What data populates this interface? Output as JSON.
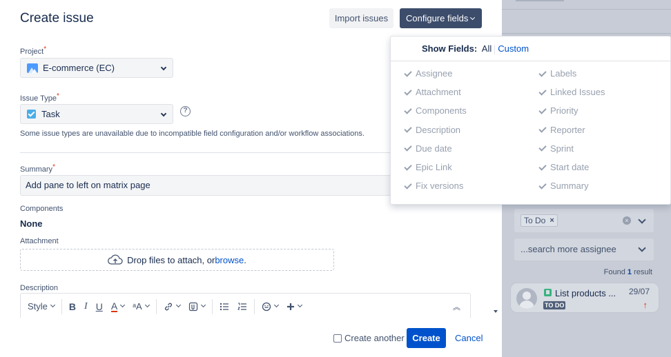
{
  "dialog": {
    "title": "Create issue",
    "import_label": "Import issues",
    "configure_label": "Configure fields"
  },
  "form": {
    "project": {
      "label": "Project",
      "required": "*",
      "value": "E-commerce (EC)"
    },
    "issue_type": {
      "label": "Issue Type",
      "required": "*",
      "value": "Task",
      "help": "?"
    },
    "note": "Some issue types are unavailable due to incompatible field configuration and/or workflow associations.",
    "summary": {
      "label": "Summary",
      "required": "*",
      "value": "Add pane to left on matrix page"
    },
    "components": {
      "label": "Components",
      "value": "None"
    },
    "attachment": {
      "label": "Attachment",
      "drop_text": "Drop files to attach, or ",
      "browse": "browse",
      "period": "."
    },
    "description": {
      "label": "Description",
      "toolbar": {
        "style": "Style",
        "bold": "B",
        "italic": "I",
        "underline": "U",
        "color": "A",
        "more_format": "ᵃA",
        "collapse": "︽"
      }
    }
  },
  "footer": {
    "create_another": "Create another",
    "create": "Create",
    "cancel": "Cancel"
  },
  "popup": {
    "heading": "Show Fields:",
    "all": "All",
    "custom": "Custom",
    "left_fields": [
      "Assignee",
      "Attachment",
      "Components",
      "Description",
      "Due date",
      "Epic Link",
      "Fix versions"
    ],
    "right_fields": [
      "Labels",
      "Linked Issues",
      "Priority",
      "Reporter",
      "Sprint",
      "Start date",
      "Summary"
    ]
  },
  "background": {
    "tag": "To Do",
    "tag_remove": "×",
    "search_more": "...search more assignee",
    "found_prefix": "Found ",
    "found_count": "1",
    "found_suffix": " result",
    "card": {
      "title": "List products ...",
      "date": "29/07",
      "status": "TO DO",
      "priority": "↑"
    }
  },
  "colors": {
    "primary": "#0052cc",
    "configure_bg": "#3c4c6b",
    "required": "#de350b",
    "overlay": "#c8ccd6"
  }
}
